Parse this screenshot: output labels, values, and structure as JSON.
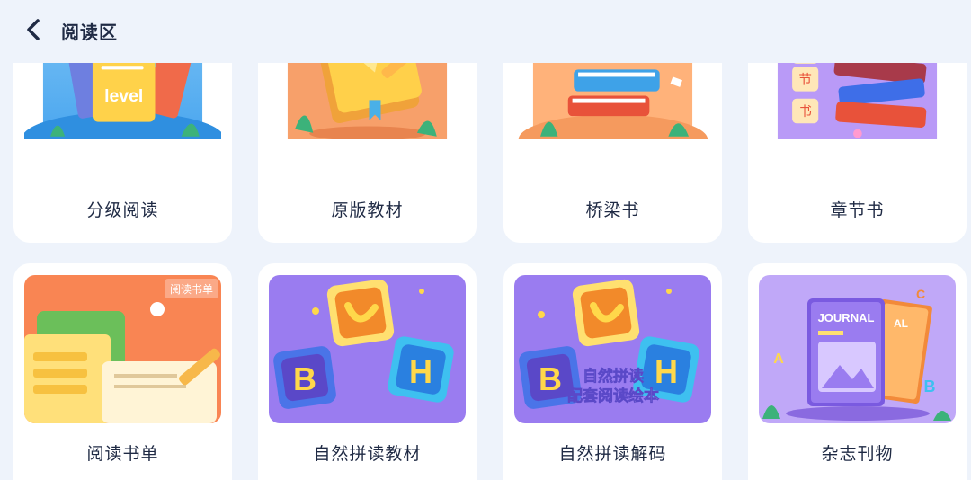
{
  "header": {
    "title": "阅读区",
    "back_icon": "chevron-left-icon"
  },
  "cards": [
    {
      "label": "分级阅读",
      "thumb_text": "level",
      "icon": "leveled-books-illustration"
    },
    {
      "label": "原版教材",
      "icon": "textbook-pencil-illustration"
    },
    {
      "label": "桥梁书",
      "icon": "book-stack-illustration"
    },
    {
      "label": "章节书",
      "thumb_chars": [
        "节",
        "书"
      ],
      "icon": "chapter-books-illustration"
    },
    {
      "label": "阅读书单",
      "thumb_text": "阅读书单",
      "icon": "reading-list-illustration"
    },
    {
      "label": "自然拼读教材",
      "thumb_letters": [
        "B",
        "H"
      ],
      "icon": "phonics-puzzle-illustration"
    },
    {
      "label": "自然拼读解码",
      "thumb_letters": [
        "B",
        "H"
      ],
      "thumb_lines": [
        "自然拼读",
        "配套阅读绘本"
      ],
      "icon": "phonics-decoding-illustration"
    },
    {
      "label": "杂志刊物",
      "thumb_text": "JOURNAL",
      "thumb_partial": "AL",
      "thumb_letters": [
        "A",
        "B",
        "C"
      ],
      "icon": "magazine-illustration"
    }
  ],
  "colors": {
    "background": "#eef3fb",
    "card": "#ffffff",
    "text": "#1f2a44",
    "orange": "#f79a62",
    "purple": "#9a7cf0"
  }
}
